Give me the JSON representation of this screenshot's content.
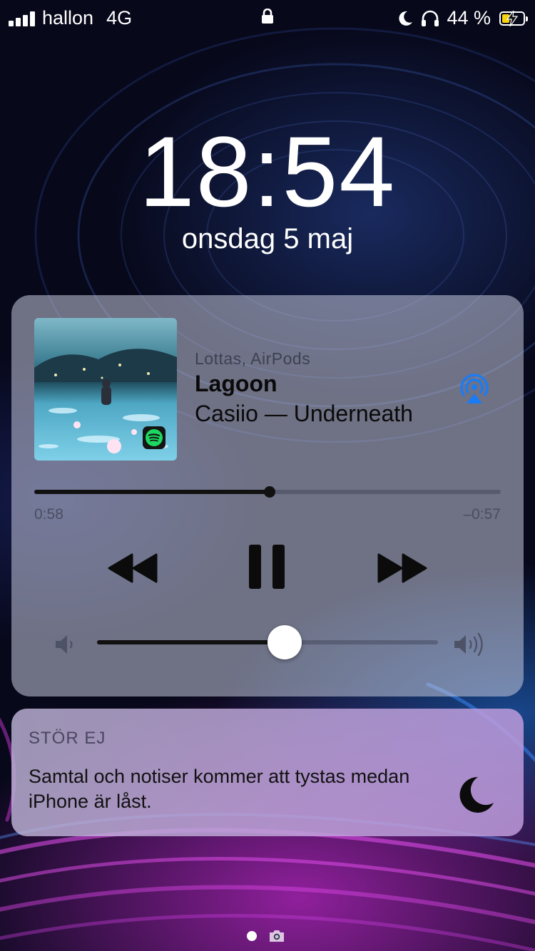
{
  "status_bar": {
    "carrier": "hallon",
    "network": "4G",
    "battery_percent_label": "44 %",
    "battery_level": 0.44,
    "icons": [
      "signal-icon",
      "lock-icon",
      "moon-icon",
      "headphones-icon",
      "battery-icon"
    ]
  },
  "lock_screen": {
    "time": "18:54",
    "date": "onsdag 5 maj"
  },
  "now_playing": {
    "route": "Lottas, AirPods",
    "title": "Lagoon",
    "subtitle": "Casiio — Underneath",
    "elapsed": "0:58",
    "remaining": "–0:57",
    "progress": 0.504,
    "volume": 0.55,
    "app_badge": "spotify-icon",
    "accent_color": "#1a7cf5",
    "controls": [
      "rewind-icon",
      "pause-icon",
      "fast-forward-icon"
    ]
  },
  "do_not_disturb": {
    "title": "STÖR EJ",
    "message": "Samtal och notiser kommer att tystas medan iPhone är låst."
  },
  "page_indicator": {
    "pages": 1,
    "active": 0
  }
}
